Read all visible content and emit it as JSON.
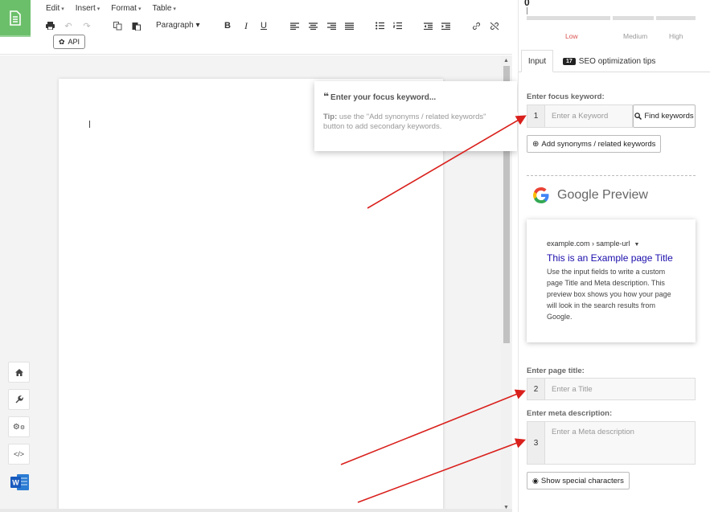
{
  "menu": [
    {
      "label": "Edit"
    },
    {
      "label": "Insert"
    },
    {
      "label": "Format"
    },
    {
      "label": "Table"
    }
  ],
  "toolbar": {
    "paragraph_label": "Paragraph",
    "icons": [
      "print-icon",
      "undo-icon",
      "redo-icon",
      "copy-icon",
      "paste-icon",
      "bold-icon",
      "italic-icon",
      "underline-icon",
      "align-left-icon",
      "align-center-icon",
      "align-right-icon",
      "align-justify-icon",
      "bullet-list-icon",
      "numbered-list-icon",
      "outdent-icon",
      "indent-icon",
      "link-icon",
      "unlink-icon"
    ],
    "bold": "B",
    "italic": "I",
    "underline": "U",
    "api_label": "API"
  },
  "tooltip": {
    "title": "Enter your focus keyword...",
    "tip_label": "Tip:",
    "tip_text": "use the \"Add synonyms / related keywords\" button to add secondary keywords."
  },
  "meter": {
    "score": "0",
    "levels": [
      {
        "label": "Low",
        "active": true
      },
      {
        "label": "Medium",
        "active": false
      },
      {
        "label": "High",
        "active": false
      }
    ],
    "active_color": "#d9534f"
  },
  "tabs": {
    "input": "Input",
    "seo_badge": "17",
    "seo": "SEO optimization tips"
  },
  "keyword": {
    "label": "Enter focus keyword:",
    "num": "1",
    "placeholder": "Enter a Keyword",
    "find_button": "Find keywords",
    "synonyms_button": "Add synonyms / related keywords"
  },
  "google_preview": {
    "heading": "Google Preview",
    "url": "example.com › sample-url",
    "title": "This is an Example page Title",
    "description": "Use the input fields to write a custom page Title and Meta description. This preview box shows you how your page will look in the search results from Google."
  },
  "page_title": {
    "label": "Enter page title:",
    "num": "2",
    "placeholder": "Enter a Title"
  },
  "meta": {
    "label": "Enter meta description:",
    "num": "3",
    "placeholder": "Enter a Meta description"
  },
  "special_chars_button": "Show special characters",
  "colors": {
    "logo_green": "#6cbf6a",
    "arrow_red": "#d9201c",
    "google_link": "#1a0dab"
  }
}
